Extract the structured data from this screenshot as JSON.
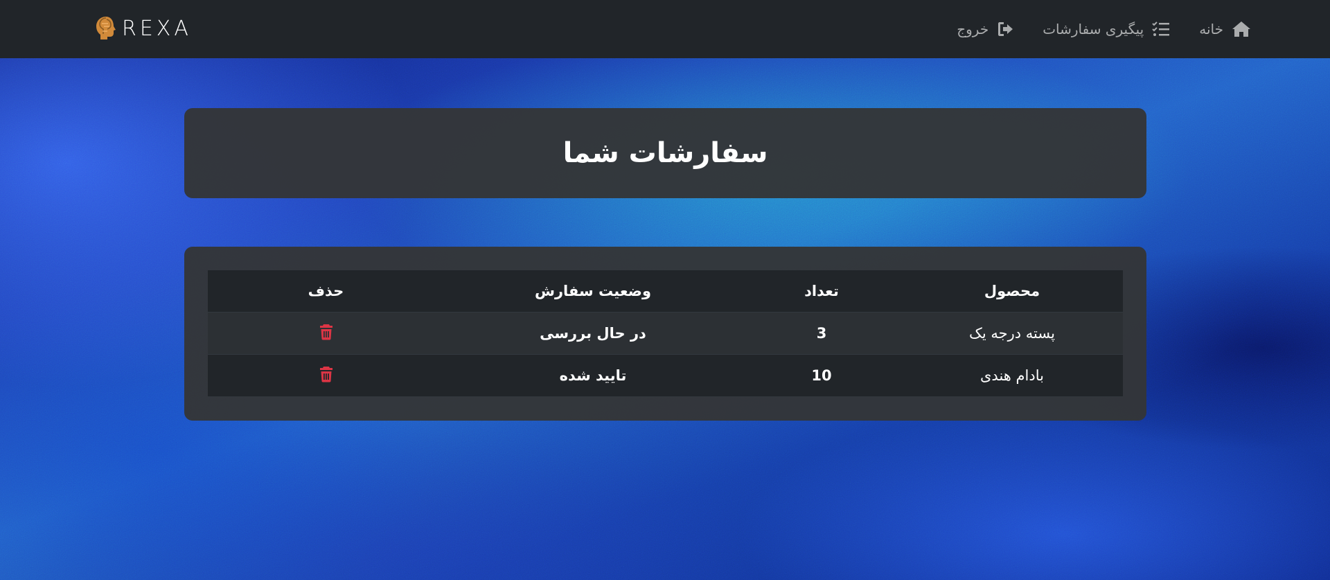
{
  "brand": {
    "name": "REXA"
  },
  "nav": {
    "home": "خانه",
    "orders_tracking": "پیگیری سفارشات",
    "logout": "خروج"
  },
  "page": {
    "title": "سفارشات شما"
  },
  "table": {
    "headers": [
      "محصول",
      "تعداد",
      "وضعیت سفارش",
      "حذف"
    ],
    "rows": [
      {
        "product": "پسته درجه یک",
        "quantity": "3",
        "status": "در حال بررسی"
      },
      {
        "product": "بادام هندی",
        "quantity": "10",
        "status": "تایید شده"
      }
    ]
  },
  "colors": {
    "navbar": "#212529",
    "card": "#343638",
    "delete_icon": "#dc3545",
    "text": "#ffffff"
  },
  "icons": {
    "home": "home-icon",
    "orders_tracking": "list-check-icon",
    "logout": "sign-out-icon",
    "delete": "trash-icon"
  }
}
